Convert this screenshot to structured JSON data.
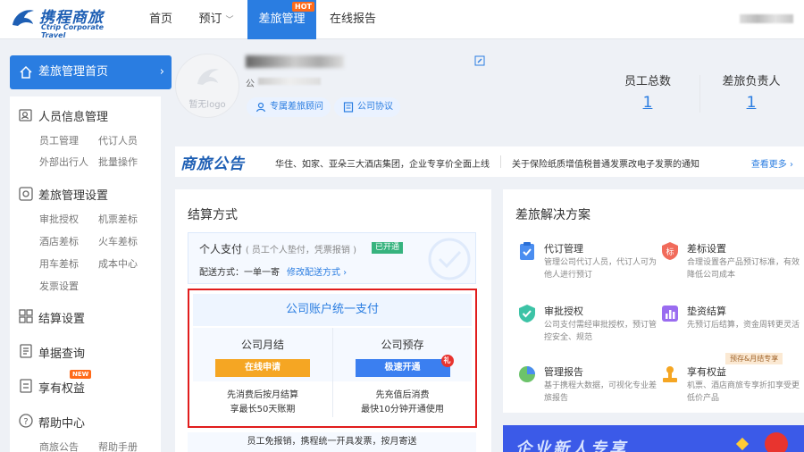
{
  "brand": {
    "name": "携程商旅",
    "sub": "Ctrip Corporate Travel"
  },
  "nav": {
    "home": "首页",
    "booking": "预订",
    "travel_mgmt": "差旅管理",
    "hot": "HOT",
    "report": "在线报告"
  },
  "sidebar": {
    "head": "差旅管理首页",
    "groups": [
      {
        "title": "人员信息管理",
        "subs": [
          "员工管理",
          "代订人员",
          "外部出行人",
          "批量操作"
        ]
      },
      {
        "title": "差旅管理设置",
        "subs": [
          "审批授权",
          "机票差标",
          "酒店差标",
          "火车差标",
          "用车差标",
          "成本中心",
          "发票设置"
        ]
      },
      {
        "title": "结算设置",
        "subs": []
      },
      {
        "title": "单据查询",
        "subs": []
      },
      {
        "title": "享有权益",
        "subs": [],
        "badge": "NEW"
      },
      {
        "title": "帮助中心",
        "subs": [
          "商旅公告",
          "帮助手册"
        ]
      }
    ]
  },
  "profile": {
    "avatar_text": "暂无logo",
    "company_prefix": "公",
    "pills": [
      "专属差旅顾问",
      "公司协议"
    ],
    "stats": [
      {
        "label": "员工总数",
        "value": "1"
      },
      {
        "label": "差旅负责人",
        "value": "1"
      }
    ]
  },
  "notice": {
    "title": "商旅公告",
    "items": [
      "华住、如家、亚朵三大酒店集团，企业专享价全面上线",
      "关于保险纸质增值税普通发票改电子发票的通知"
    ],
    "more": "查看更多 ›"
  },
  "settlement": {
    "title": "结算方式",
    "personal": {
      "title": "个人支付",
      "hint": "( 员工个人垫付，凭票报销 )",
      "status": "已开通",
      "delivery": "配送方式：一单一寄",
      "modify": "修改配送方式 ›"
    },
    "company": {
      "title": "公司账户统一支付",
      "monthly": {
        "label": "公司月结",
        "btn": "在线申请",
        "note1": "先消费后按月结算",
        "note2": "享最长50天账期"
      },
      "prepay": {
        "label": "公司预存",
        "btn": "极速开通",
        "gift": "礼",
        "note1": "先充值后消费",
        "note2": "最快10分钟开通使用"
      }
    },
    "footer": "员工免报销，携程统一开具发票，按月寄送"
  },
  "solutions": {
    "title": "差旅解决方案",
    "items": [
      {
        "title": "代订管理",
        "desc": "管理公司代订人员，代订人可为他人进行预订"
      },
      {
        "title": "差标设置",
        "desc": "合理设置各产品预订标准，有效降低公司成本"
      },
      {
        "title": "审批授权",
        "desc": "公司支付需经审批授权，预订管控安全、规范"
      },
      {
        "title": "垫资结算",
        "desc": "先预订后结算，资金周转更灵活"
      },
      {
        "title": "管理报告",
        "desc": "基于携程大数据，可视化专业差旅报告"
      },
      {
        "title": "享有权益",
        "desc": "机票、酒店商旅专享折扣享受更低价产品"
      }
    ],
    "tag": "预存&月结专享",
    "banner": "企业新人专享"
  }
}
